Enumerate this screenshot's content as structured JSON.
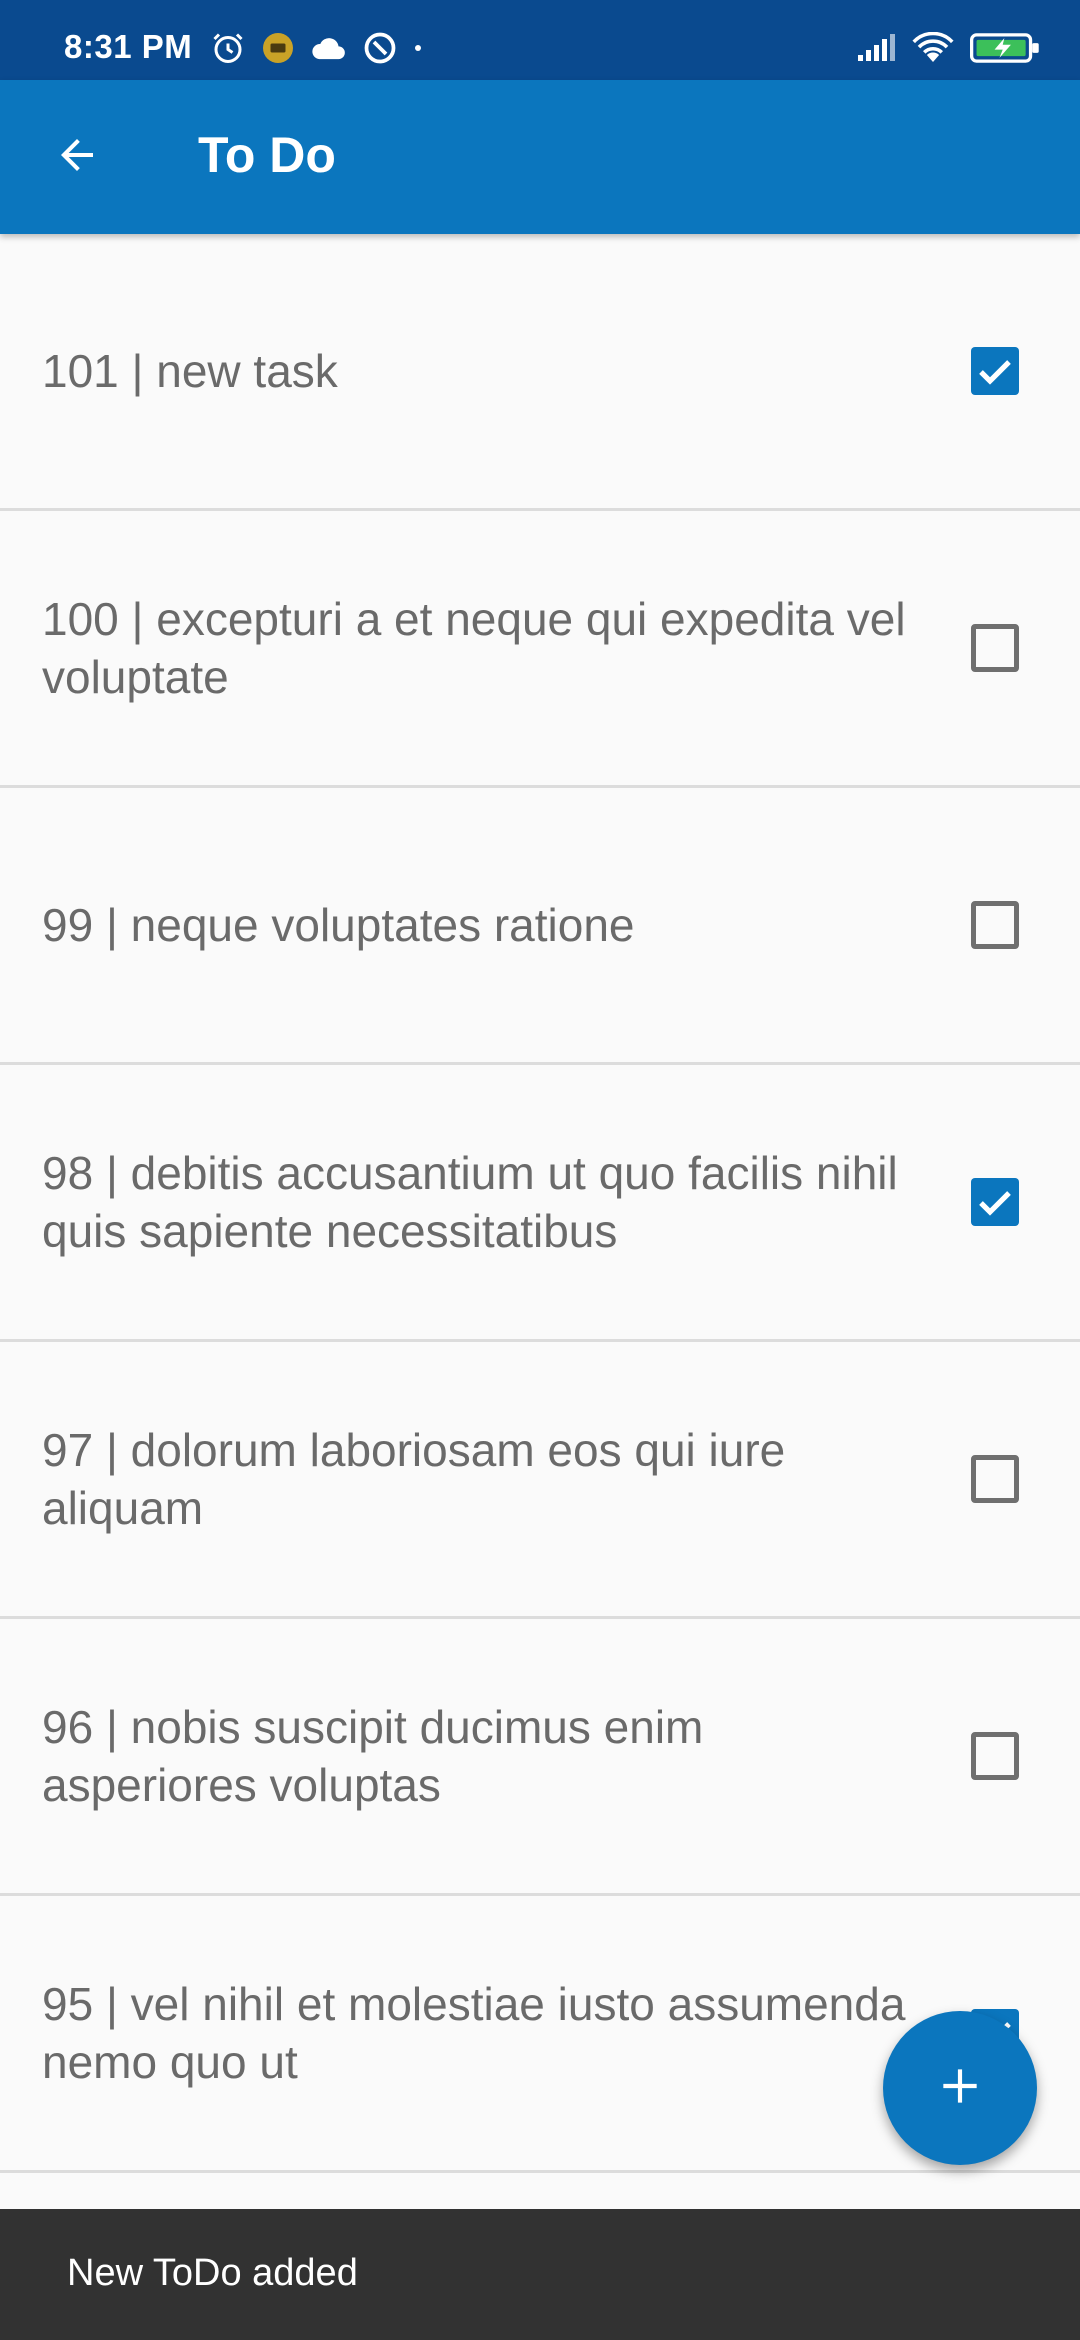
{
  "status_bar": {
    "time": "8:31 PM",
    "left_icons": [
      "alarm-icon",
      "notification-badge-icon",
      "cloud-icon",
      "sync-disabled-icon",
      "dot-icon"
    ],
    "right_icons": [
      "signal-icon",
      "wifi-icon",
      "battery-charging-icon"
    ]
  },
  "app_bar": {
    "title": "To Do",
    "back_icon": "arrow-back-icon"
  },
  "todos": [
    {
      "label": "101 | new task",
      "checked": true
    },
    {
      "label": "100 | excepturi a et neque qui expedita vel voluptate",
      "checked": false
    },
    {
      "label": "99 | neque voluptates ratione",
      "checked": false
    },
    {
      "label": "98 | debitis accusantium ut quo facilis nihil quis sapiente necessitatibus",
      "checked": true
    },
    {
      "label": "97 | dolorum laboriosam eos qui iure aliquam",
      "checked": false
    },
    {
      "label": "96 | nobis suscipit ducimus enim asperiores voluptas",
      "checked": false
    },
    {
      "label": "95 | vel nihil et molestiae iusto assumenda nemo quo ut",
      "checked": true
    }
  ],
  "fab": {
    "icon": "plus-icon"
  },
  "snackbar": {
    "message": "New ToDo added"
  },
  "colors": {
    "primary": "#0b76be",
    "status_bar": "#0a4a8f",
    "snackbar": "#323232"
  }
}
